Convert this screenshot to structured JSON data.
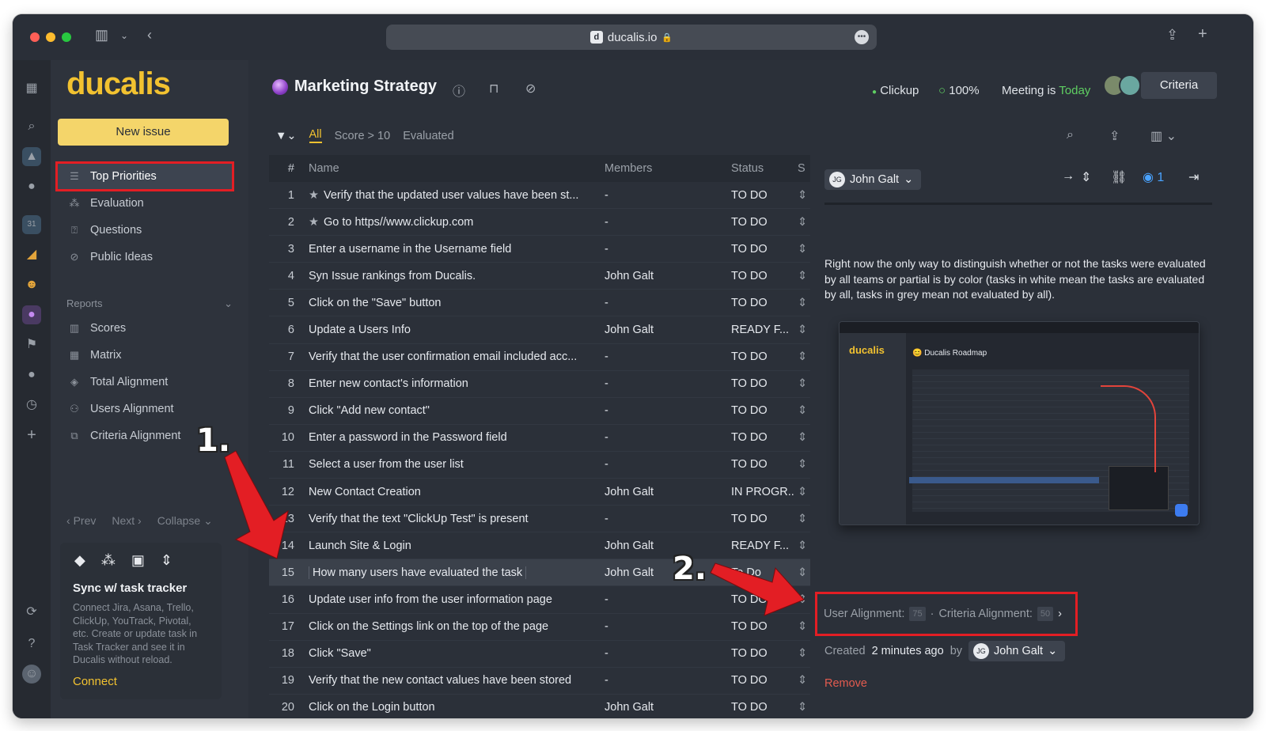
{
  "browser": {
    "url": "ducalis.io",
    "favicon": "d"
  },
  "sidebar": {
    "logo": "ducalis",
    "new_issue": "New issue",
    "items": [
      {
        "label": "Top Priorities",
        "icon": "list-icon"
      },
      {
        "label": "Evaluation",
        "icon": "nodes-icon"
      },
      {
        "label": "Questions",
        "icon": "question-icon"
      },
      {
        "label": "Public Ideas",
        "icon": "megaphone-icon"
      }
    ],
    "reports_label": "Reports",
    "reports": [
      {
        "label": "Scores",
        "icon": "columns-icon"
      },
      {
        "label": "Matrix",
        "icon": "grid-icon"
      },
      {
        "label": "Total Alignment",
        "icon": "layers-icon"
      },
      {
        "label": "Users Alignment",
        "icon": "users-icon"
      },
      {
        "label": "Criteria Alignment",
        "icon": "copy-icon"
      }
    ],
    "pager": {
      "prev": "Prev",
      "next": "Next",
      "collapse": "Collapse"
    },
    "sync": {
      "title": "Sync w/ task tracker",
      "text": "Connect Jira, Asana, Trello, ClickUp, YouTrack, Pivotal, etc. Create or update task in Task Tracker and see it in Ducalis without reload.",
      "connect": "Connect"
    }
  },
  "header": {
    "title": "Marketing Strategy",
    "integration": "Clickup",
    "progress": "100%",
    "meeting_prefix": "Meeting is",
    "meeting_when": "Today",
    "criteria_btn": "Criteria"
  },
  "filters": {
    "all": "All",
    "score": "Score > 10",
    "evaluated": "Evaluated"
  },
  "table": {
    "headers": {
      "num": "#",
      "name": "Name",
      "members": "Members",
      "status": "Status",
      "s": "S"
    },
    "rows": [
      {
        "n": "1",
        "name": "Verify that the updated user values have been st...",
        "members": "-",
        "status": "TO DO",
        "star": true
      },
      {
        "n": "2",
        "name": "Go to https//www.clickup.com",
        "members": "-",
        "status": "TO DO",
        "star": true
      },
      {
        "n": "3",
        "name": "Enter a username in the Username field",
        "members": "-",
        "status": "TO DO"
      },
      {
        "n": "4",
        "name": "Syn Issue rankings from Ducalis.",
        "members": "John Galt",
        "status": "TO DO"
      },
      {
        "n": "5",
        "name": "Click on the \"Save\" button",
        "members": "-",
        "status": "TO DO"
      },
      {
        "n": "6",
        "name": "Update a Users Info",
        "members": "John Galt",
        "status": "READY F..."
      },
      {
        "n": "7",
        "name": "Verify that the user confirmation email included acc...",
        "members": "-",
        "status": "TO DO"
      },
      {
        "n": "8",
        "name": "Enter new contact's information",
        "members": "-",
        "status": "TO DO"
      },
      {
        "n": "9",
        "name": "Click \"Add new contact\"",
        "members": "-",
        "status": "TO DO"
      },
      {
        "n": "10",
        "name": "Enter a password in the Password field",
        "members": "-",
        "status": "TO DO"
      },
      {
        "n": "11",
        "name": "Select a user from the user list",
        "members": "-",
        "status": "TO DO"
      },
      {
        "n": "12",
        "name": "New Contact Creation",
        "members": "John Galt",
        "status": "IN PROGR..."
      },
      {
        "n": "13",
        "name": "Verify that the text \"ClickUp Test\" is present",
        "members": "-",
        "status": "TO DO"
      },
      {
        "n": "14",
        "name": "Launch Site & Login",
        "members": "John Galt",
        "status": "READY F..."
      },
      {
        "n": "15",
        "name": "How many users have evaluated the task",
        "members": "John Galt",
        "status": "To Do",
        "selected": true
      },
      {
        "n": "16",
        "name": "Update user info from the user information page",
        "members": "-",
        "status": "TO DO"
      },
      {
        "n": "17",
        "name": "Click on the Settings link on the top of the page",
        "members": "-",
        "status": "TO DO"
      },
      {
        "n": "18",
        "name": "Click \"Save\"",
        "members": "-",
        "status": "TO DO"
      },
      {
        "n": "19",
        "name": "Verify that the new contact values have been stored",
        "members": "-",
        "status": "TO DO"
      },
      {
        "n": "20",
        "name": "Click on the Login button",
        "members": "John Galt",
        "status": "TO DO"
      }
    ]
  },
  "panel": {
    "assignee": "John Galt",
    "assignee_initials": "JG",
    "watchers": "1",
    "description": "Right now the only way to distinguish whether or not the tasks were evaluated by all teams or partial is by color (tasks in white mean the tasks are evaluated by all, tasks in grey mean not evaluated by all).",
    "thumb_logo": "ducalis",
    "thumb_title": "Ducalis Roadmap",
    "user_alignment_label": "User Alignment:",
    "user_alignment_value": "75",
    "criteria_alignment_label": "Criteria Alignment:",
    "criteria_alignment_value": "50",
    "created_prefix": "Created",
    "created_time": "2 minutes ago",
    "created_by": "by",
    "creator": "John Galt",
    "remove": "Remove"
  },
  "annotations": {
    "one": "1.",
    "two": "2."
  },
  "colors": {
    "accent": "#f2c230",
    "highlight": "#e31e24",
    "today": "#5fcf62"
  }
}
